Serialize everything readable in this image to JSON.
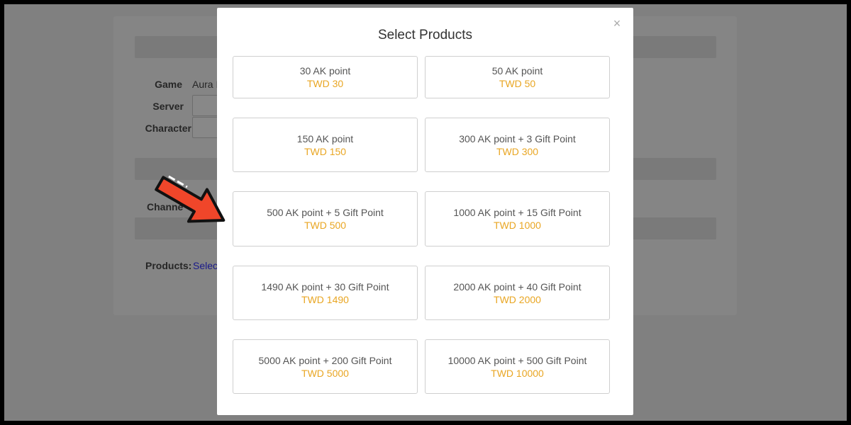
{
  "background_page": {
    "game_label": "Game",
    "game_value": "Aura I",
    "server_label": "Server",
    "character_label": "Character",
    "channel_label": "Channe",
    "products_label": "Products:",
    "products_link": "Selec"
  },
  "modal": {
    "title": "Select Products",
    "close_glyph": "×",
    "products": [
      {
        "name": "30 AK point",
        "price": "TWD 30"
      },
      {
        "name": "50 AK point",
        "price": "TWD 50"
      },
      {
        "name": "150 AK point",
        "price": "TWD 150"
      },
      {
        "name": "300 AK point + 3 Gift Point",
        "price": "TWD 300"
      },
      {
        "name": "500 AK point + 5 Gift Point",
        "price": "TWD 500"
      },
      {
        "name": "1000 AK point + 15 Gift Point",
        "price": "TWD 1000"
      },
      {
        "name": "1490 AK point + 30 Gift Point",
        "price": "TWD 1490"
      },
      {
        "name": "2000 AK point + 40 Gift Point",
        "price": "TWD 2000"
      },
      {
        "name": "5000 AK point + 200 Gift Point",
        "price": "TWD 5000"
      },
      {
        "name": "10000 AK point + 500 Gift Point",
        "price": "TWD 10000"
      }
    ]
  },
  "colors": {
    "price": "#e9a623",
    "overlay": "#808080",
    "arrow_fill": "#f0462a"
  }
}
